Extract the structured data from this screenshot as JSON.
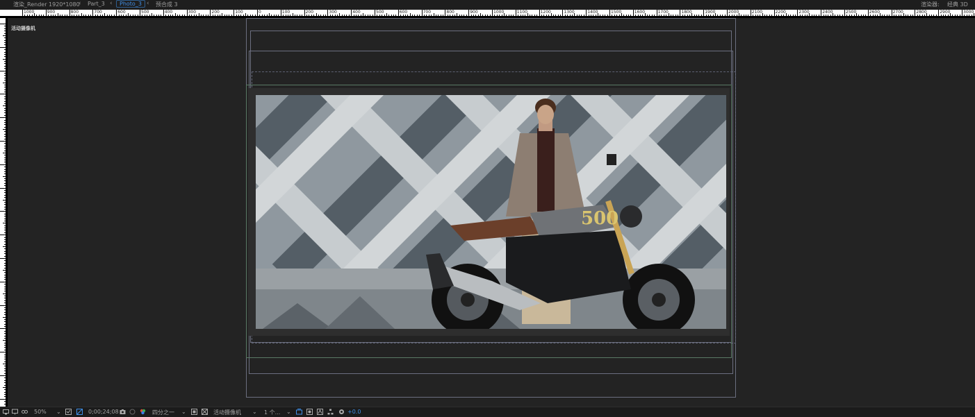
{
  "breadcrumbs": [
    {
      "label": "渲染_Render 1920*1080",
      "active": false
    },
    {
      "label": "Part_3",
      "active": false
    },
    {
      "label": "Photo_3",
      "active": true
    },
    {
      "label": "预合成 3",
      "active": false
    }
  ],
  "renderer": {
    "label": "渲染器:",
    "value": "经典 3D"
  },
  "ruler_labels": [
    "1000",
    "900",
    "800",
    "700",
    "600",
    "500",
    "400",
    "300",
    "200",
    "100",
    "0",
    "100",
    "200",
    "300",
    "400",
    "500",
    "600",
    "700",
    "800",
    "900",
    "1000",
    "1100",
    "1200",
    "1300",
    "1400",
    "1500",
    "1600",
    "1700",
    "1800",
    "1900",
    "2000",
    "2100",
    "2200",
    "2300",
    "2400",
    "2500",
    "2600",
    "2700",
    "2800",
    "2900",
    "3000"
  ],
  "viewer": {
    "camera_label": "活动摄像机"
  },
  "photo": {
    "badge_text": "500"
  },
  "bottom_toolbar": {
    "zoom": "50%",
    "timecode": "0;00;24;08",
    "resolution": "四分之一",
    "view_camera": "活动摄像机",
    "view_count": "1 个...",
    "exposure": "+0.0"
  },
  "colors": {
    "accent": "#3f8fe8",
    "panel": "#232323",
    "ruler": "#ffffff"
  }
}
